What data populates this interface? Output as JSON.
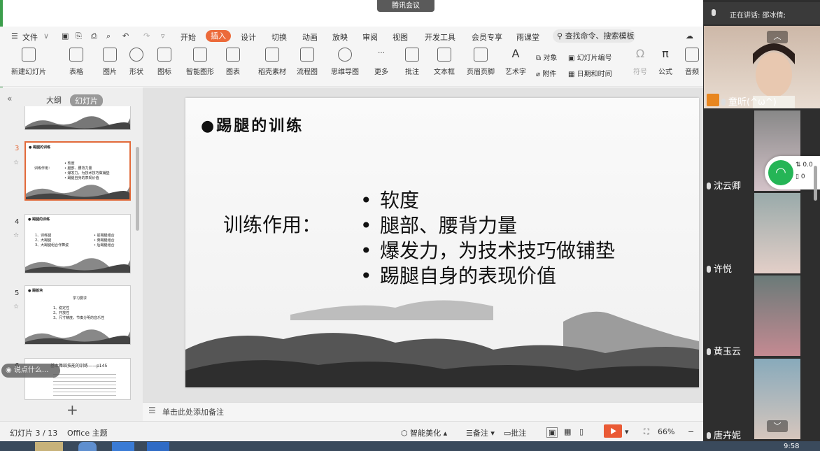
{
  "meeting": {
    "tag": "腾讯会议",
    "speaking_now": "正在讲话: 邵冰倩;"
  },
  "menu": {
    "file": "文件",
    "tabs": [
      "开始",
      "插入",
      "设计",
      "切换",
      "动画",
      "放映",
      "审阅",
      "视图",
      "开发工具",
      "会员专享",
      "雨课堂"
    ],
    "active_tab": "插入",
    "search": "查找命令、搜索模板"
  },
  "ribbon": {
    "new_slide": "新建幻灯片",
    "table": "表格",
    "picture": "图片",
    "shape": "形状",
    "icon": "图标",
    "smart_graphic": "智能图形",
    "chart": "图表",
    "shell_material": "稻壳素材",
    "flowchart": "流程图",
    "mindmap": "思维导图",
    "more": "更多",
    "comment": "批注",
    "textbox": "文本框",
    "header_footer": "页眉页脚",
    "art_text": "艺术字",
    "object": "对象",
    "slide_number": "幻灯片编号",
    "attachment": "附件",
    "date_time": "日期和时间",
    "symbol": "符号",
    "formula": "公式",
    "audio": "音频"
  },
  "pane": {
    "outline": "大纲",
    "slides": "幻灯片",
    "add": "+"
  },
  "thumbs": [
    {
      "num": "3",
      "title": "● 踢腿的训练",
      "label": "训练作用：",
      "items": [
        "• 软度",
        "• 腿部、腰背力量",
        "• 爆发力，为技术技巧做铺垫",
        "• 踢腿自身的表现价值"
      ]
    },
    {
      "num": "4",
      "title": "● 踢腿的训练",
      "left": [
        "1、训练腿",
        "2、大踢腿",
        "3、大踢腿组合作舞姿"
      ],
      "right": [
        "• 前踢腿组合",
        "• 旁踢腿组合",
        "• 后踢腿组合"
      ]
    },
    {
      "num": "5",
      "title": "● 踢板块",
      "head": "学习要求",
      "items": [
        "1、稳定性",
        "2、开放性",
        "3、尺寸精度，节奏分明的音乐性"
      ]
    },
    {
      "num": "6",
      "title": "基本舞蹈技能的训练——p145",
      "placeholder": "说点什么..."
    }
  ],
  "slide": {
    "title": "●踢腿的训练",
    "label": "训练作用：",
    "bullets": [
      "软度",
      "腿部、腰背力量",
      "爆发力，为技术技巧做铺垫",
      "踢腿自身的表现价值"
    ]
  },
  "notes": {
    "placeholder": "单击此处添加备注"
  },
  "status": {
    "slide_counter": "幻灯片 3 / 13",
    "theme": "Office 主题",
    "beautify": "智能美化",
    "notes": "备注",
    "comment": "批注",
    "zoom": "66%"
  },
  "participants": [
    {
      "name": "童昕(^ω^)"
    },
    {
      "name": "沈云卿"
    },
    {
      "name": "许悦"
    },
    {
      "name": "黄玉云"
    },
    {
      "name": "唐卉妮"
    }
  ],
  "wifi": {
    "speed": "0.0",
    "count": "0"
  },
  "clock": "9:58",
  "colors": {
    "accent": "#ec6a3a",
    "play": "#ea5a35",
    "panel": "#2e2e2e"
  }
}
